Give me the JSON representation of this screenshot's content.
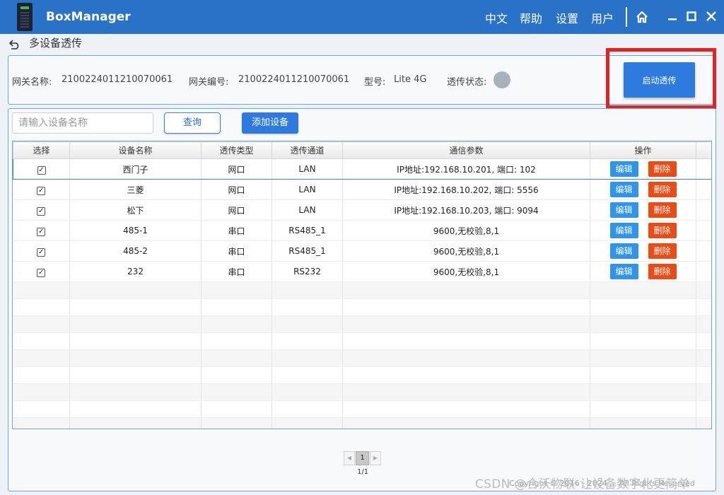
{
  "app": {
    "title": "BoxManager"
  },
  "menu": {
    "language": "中文",
    "help": "帮助",
    "settings": "设置",
    "user": "用户"
  },
  "page": {
    "title": "多设备透传"
  },
  "gateway": {
    "name_label": "网关名称:",
    "name_value": "2100224011210070061",
    "id_label": "网关编号:",
    "id_value": "2100224011210070061",
    "model_label": "型号:",
    "model_value": "Lite 4G",
    "status_label": "透传状态:",
    "status_color": "#a7b1bb"
  },
  "actions": {
    "start_label": "启动透传",
    "query_label": "查询",
    "add_label": "添加设备"
  },
  "search": {
    "placeholder": "请输入设备名称"
  },
  "table": {
    "headers": [
      "选择",
      "设备名称",
      "透传类型",
      "透传通道",
      "通信参数",
      "操作"
    ],
    "edit_label": "编辑",
    "delete_label": "删除",
    "rows": [
      {
        "checked": true,
        "name": "西门子",
        "type": "网口",
        "channel": "LAN",
        "params": "IP地址:192.168.10.201, 端口: 102"
      },
      {
        "checked": true,
        "name": "三菱",
        "type": "网口",
        "channel": "LAN",
        "params": "IP地址:192.168.10.202, 端口: 5556"
      },
      {
        "checked": true,
        "name": "松下",
        "type": "网口",
        "channel": "LAN",
        "params": "IP地址:192.168.10.203, 端口: 9094"
      },
      {
        "checked": true,
        "name": "485-1",
        "type": "串口",
        "channel": "RS485_1",
        "params": "9600,无校验,8,1"
      },
      {
        "checked": true,
        "name": "485-2",
        "type": "串口",
        "channel": "RS485_1",
        "params": "9600,无校验,8,1"
      },
      {
        "checked": true,
        "name": "232",
        "type": "串口",
        "channel": "RS232",
        "params": "9600,无校验,8,1"
      }
    ]
  },
  "pagination": {
    "current": "1",
    "total": "1/1"
  },
  "footer": {
    "copyright": "Copyright © 2016 - 2024 ... All Rights Reserved",
    "watermark": "CSDN @合沃物联-让设备数字化更简单"
  },
  "colors": {
    "titlebar": "#2a72c8",
    "primary_button": "#2e7be0",
    "delete_button": "#ee4a14",
    "highlight_border": "#e8201f"
  }
}
